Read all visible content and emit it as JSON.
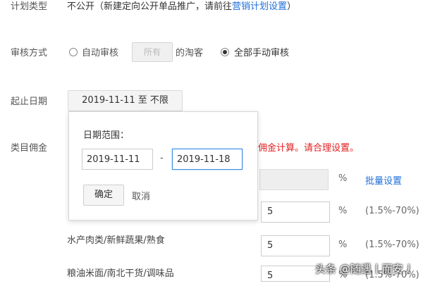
{
  "plan_type": {
    "label": "计划类型",
    "value_prefix": "不公开（新建定向公开单品推广，请前往",
    "link": "营销计划设置",
    "value_suffix": "）"
  },
  "review_method": {
    "label": "审核方式",
    "auto_review_label": "自动审核",
    "all_button_label": "所有",
    "customers_text": "的淘客",
    "manual_review_label": "全部手动审核",
    "selected": "manual"
  },
  "date_range": {
    "label": "起止日期",
    "button_label": "2019-11-11 至 不限"
  },
  "date_popup": {
    "title": "日期范围：",
    "start_value": "2019-11-11",
    "separator": "-",
    "end_value": "2019-11-18",
    "confirm_label": "确定",
    "cancel_label": "取消"
  },
  "category_commission": {
    "label": "类目佣金",
    "warning_text": "佣金计算。请合理设置。",
    "batch_set_label": "批量设置",
    "rows": [
      {
        "name": "",
        "value": "",
        "percent": "%",
        "range": ""
      },
      {
        "name": "",
        "value": "5",
        "percent": "%",
        "range": "(1.5%-70%)"
      },
      {
        "name": "水产肉类/新鲜蔬果/熟食",
        "value": "5",
        "percent": "%",
        "range": "(1.5%-70%)"
      },
      {
        "name": "粮油米面/南北干货/调味品",
        "value": "5",
        "percent": "%",
        "range": "(1.5%-70%)"
      }
    ]
  },
  "watermark": "头条 @随遇丨而安丿",
  "colors": {
    "link": "#1e6fd9",
    "warning": "#e02020",
    "focus_border": "#3a8ee6"
  }
}
